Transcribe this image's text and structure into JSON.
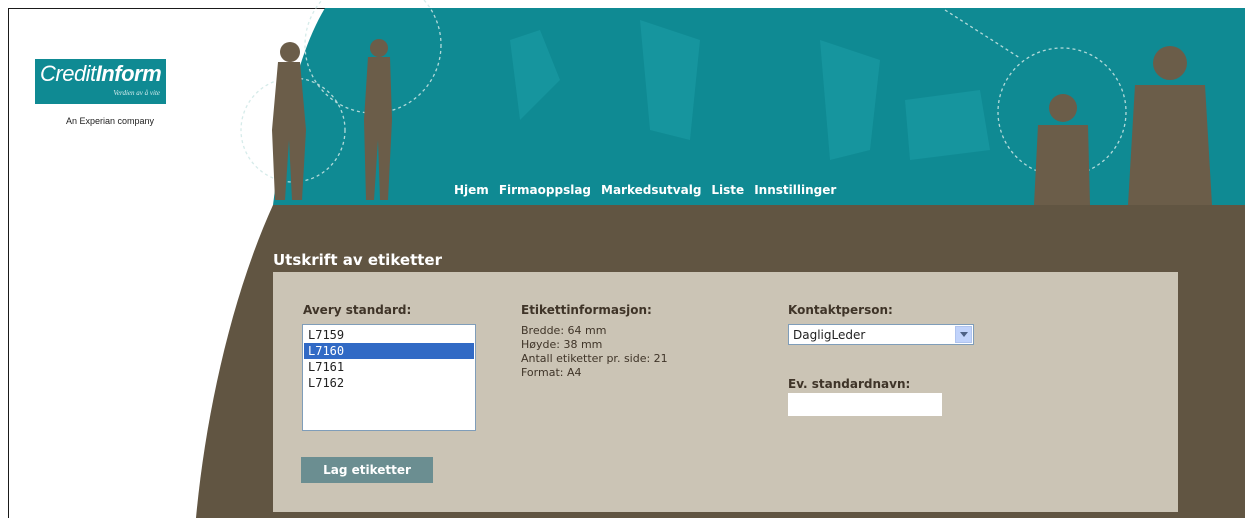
{
  "brand": {
    "name_light": "Credit",
    "name_bold": "Inform",
    "tagline": "Verdien av å vite",
    "company": "An Experian company"
  },
  "nav": {
    "items": [
      "Hjem",
      "Firmaoppslag",
      "Markedsutvalg",
      "Liste",
      "Innstillinger"
    ]
  },
  "page": {
    "title": "Utskrift av etiketter"
  },
  "avery": {
    "label": "Avery standard:",
    "options": [
      "L7159",
      "L7160",
      "L7161",
      "L7162"
    ],
    "selected": "L7160"
  },
  "etikett": {
    "label": "Etikettinformasjon:",
    "lines": [
      "Bredde: 64 mm",
      "Høyde: 38 mm",
      "Antall etiketter pr. side: 21",
      "Format: A4"
    ]
  },
  "kontakt": {
    "label": "Kontaktperson:",
    "value": "DagligLeder"
  },
  "standardnavn": {
    "label": "Ev. standardnavn:",
    "value": ""
  },
  "button": {
    "label": "Lag etiketter"
  },
  "colors": {
    "teal": "#0f8a93",
    "brown": "#615542",
    "panel": "#cbc4b5",
    "button": "#6b8e91",
    "selected": "#316ac5"
  }
}
